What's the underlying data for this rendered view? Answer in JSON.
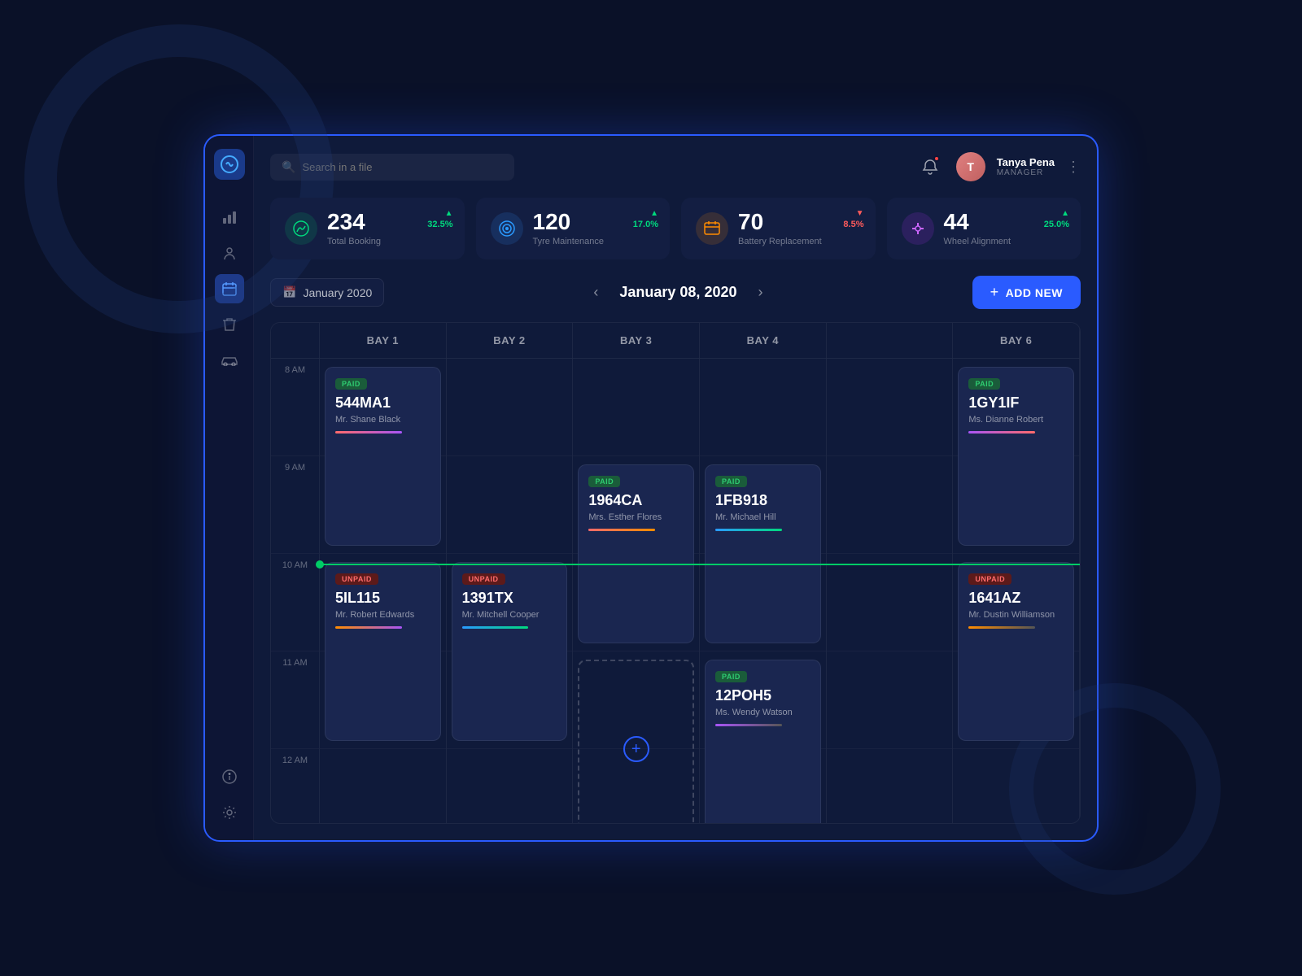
{
  "app": {
    "logo_text": "⊕",
    "search_placeholder": "Search in a file"
  },
  "header": {
    "user_name": "Tanya Pena",
    "user_role": "MANAGER",
    "user_initials": "T"
  },
  "stats": [
    {
      "id": "total-booking",
      "icon": "🎯",
      "icon_class": "green",
      "number": "234",
      "label": "Total Booking",
      "change": "32.5%",
      "direction": "up"
    },
    {
      "id": "tyre-maintenance",
      "icon": "⚙️",
      "icon_class": "blue",
      "number": "120",
      "label": "Tyre Maintenance",
      "change": "17.0%",
      "direction": "up"
    },
    {
      "id": "battery-replacement",
      "icon": "🔋",
      "icon_class": "orange",
      "number": "70",
      "label": "Battery Replacement",
      "change": "8.5%",
      "direction": "down"
    },
    {
      "id": "wheel-alignment",
      "icon": "⚖️",
      "icon_class": "purple",
      "number": "44",
      "label": "Wheel Alignment",
      "change": "25.0%",
      "direction": "up"
    }
  ],
  "calendar": {
    "month_label": "January 2020",
    "current_date": "January 08, 2020",
    "add_new_label": "ADD NEW"
  },
  "schedule": {
    "bays": [
      "BAY 1",
      "BAY 2",
      "BAY 3",
      "BAY 4",
      "BAY 6"
    ],
    "times": [
      "8 AM",
      "9 AM",
      "10 AM",
      "11 AM",
      "12 AM"
    ],
    "bookings": [
      {
        "id": "b1",
        "bay": 0,
        "row_start": 0,
        "row_span": 2,
        "status": "PAID",
        "status_class": "paid",
        "booking_id": "544MA1",
        "name": "Mr. Shane Black",
        "bar_color": "linear-gradient(to right, #ff6b6b, #a855f7)"
      },
      {
        "id": "b2",
        "bay": 0,
        "row_start": 2,
        "row_span": 2,
        "status": "UNPAID",
        "status_class": "unpaid",
        "booking_id": "5IL115",
        "name": "Mr. Robert Edwards",
        "bar_color": "linear-gradient(to right, #ff8c00, #a855f7)"
      },
      {
        "id": "b3",
        "bay": 1,
        "row_start": 2,
        "row_span": 2,
        "status": "UNPAID",
        "status_class": "unpaid",
        "booking_id": "1391TX",
        "name": "Mr. Mitchell Cooper",
        "bar_color": "linear-gradient(to right, #2a9aff, #00d97e)"
      },
      {
        "id": "b4",
        "bay": 2,
        "row_start": 1,
        "row_span": 2,
        "status": "PAID",
        "status_class": "paid",
        "booking_id": "1964CA",
        "name": "Mrs. Esther Flores",
        "bar_color": "linear-gradient(to right, #ff6b6b, #ff8c00)"
      },
      {
        "id": "b5",
        "bay": 2,
        "row_start": 3,
        "row_span": 2,
        "status": "",
        "status_class": "",
        "booking_id": "",
        "name": "",
        "bar_color": "",
        "is_add": true
      },
      {
        "id": "b6",
        "bay": 3,
        "row_start": 1,
        "row_span": 2,
        "status": "PAID",
        "status_class": "paid",
        "booking_id": "1FB918",
        "name": "Mr. Michael Hill",
        "bar_color": "linear-gradient(to right, #2a9aff, #00d97e)"
      },
      {
        "id": "b7",
        "bay": 3,
        "row_start": 3,
        "row_span": 2,
        "status": "PAID",
        "status_class": "paid",
        "booking_id": "12POH5",
        "name": "Ms. Wendy Watson",
        "bar_color": "linear-gradient(to right, #a855f7, #555)"
      },
      {
        "id": "b8",
        "bay": 4,
        "row_start": 0,
        "row_span": 2,
        "status": "PAID",
        "status_class": "paid",
        "booking_id": "1GY1IF",
        "name": "Ms. Dianne Robert",
        "bar_color": "linear-gradient(to right, #a855f7, #ff6b6b)"
      },
      {
        "id": "b9",
        "bay": 4,
        "row_start": 2,
        "row_span": 2,
        "status": "UNPAID",
        "status_class": "unpaid",
        "booking_id": "1641AZ",
        "name": "Mr. Dustin Williamson",
        "bar_color": "linear-gradient(to right, #ff8c00, #555)"
      }
    ]
  },
  "sidebar": {
    "icons": [
      {
        "name": "chart-icon",
        "glyph": "◑",
        "active": false
      },
      {
        "name": "user-icon",
        "glyph": "👤",
        "active": false
      },
      {
        "name": "calendar-icon",
        "glyph": "📅",
        "active": true
      },
      {
        "name": "trash-icon",
        "glyph": "🗑",
        "active": false
      },
      {
        "name": "truck-icon",
        "glyph": "🚗",
        "active": false
      }
    ],
    "bottom_icons": [
      {
        "name": "info-icon",
        "glyph": "ℹ",
        "active": false
      },
      {
        "name": "settings-icon",
        "glyph": "⚙",
        "active": false
      }
    ]
  }
}
